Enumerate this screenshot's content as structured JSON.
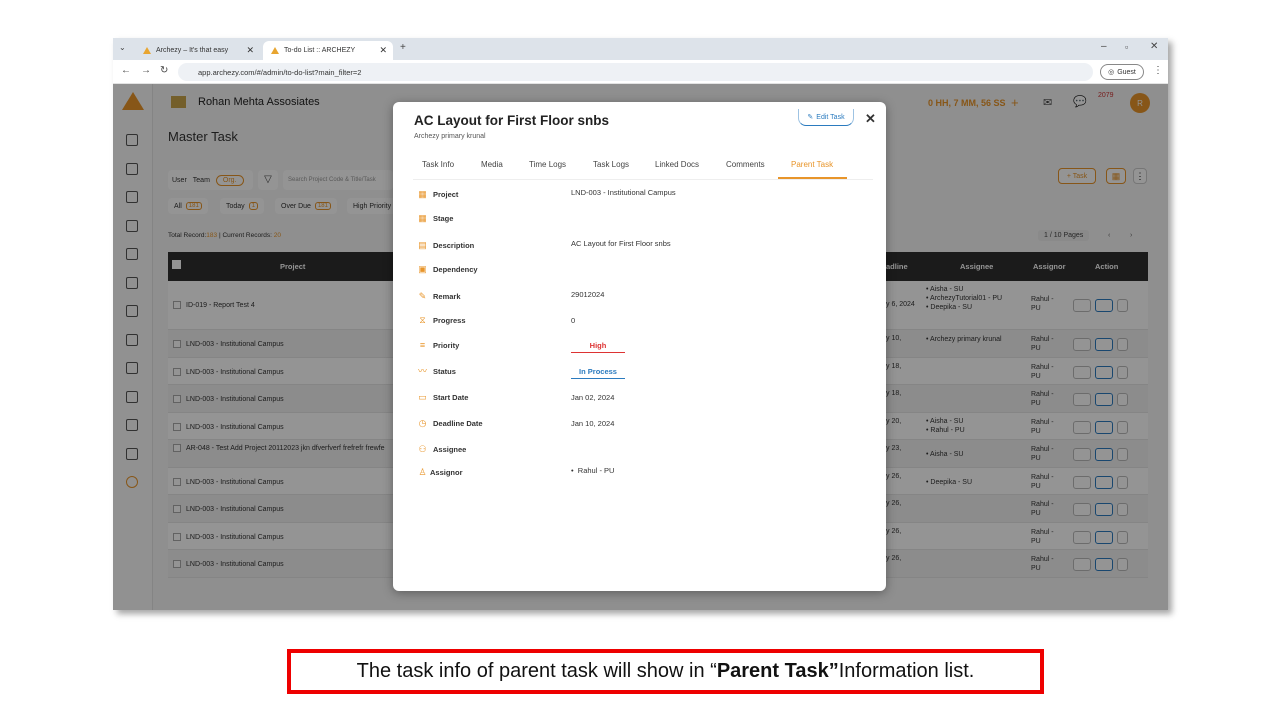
{
  "browser": {
    "tabs": [
      {
        "title": "Archezy – It's that easy",
        "active": false
      },
      {
        "title": "To-do List :: ARCHEZY",
        "active": true
      }
    ],
    "url": "app.archezy.com/#/admin/to-do-list?main_filter=2",
    "profile_label": "Guest"
  },
  "app": {
    "org_name": "Rohan Mehta Assosiates",
    "page_title": "Master Task",
    "timer": "0 HH, 7 MM, 56 SS",
    "avatar_initial": "R",
    "notification_year": "2079",
    "filter": {
      "user": "User",
      "team": "Team",
      "org": "Org."
    },
    "search_placeholder": "Search Project Code & Title/Task",
    "chips": [
      {
        "label": "All",
        "count": "181"
      },
      {
        "label": "Today",
        "count": "1"
      },
      {
        "label": "Over Due",
        "count": "181"
      },
      {
        "label": "High Priority",
        "count": ""
      }
    ],
    "total_label": "Total Record:",
    "total_value": "183",
    "current_label": " | Current Records: ",
    "current_value": "20",
    "pages": "1 / 10 Pages",
    "task_button": "+ Task",
    "columns": {
      "project": "Project",
      "deadline": "adline",
      "assignee": "Assignee",
      "assignor": "Assignor",
      "action": "Action"
    },
    "rows": [
      {
        "project": "ID-019 - Report Test 4",
        "deadline": "y 6, 2024",
        "assignee": [
          "Aisha - SU",
          "ArchezyTutorial01 - PU",
          "Deepika - SU"
        ],
        "assignor": "Rahul - PU"
      },
      {
        "project": "LND-003 - Institutional Campus",
        "deadline": "y 10,",
        "assignee": [
          "Archezy primary krunal"
        ],
        "assignor": "Rahul - PU"
      },
      {
        "project": "LND-003 - Institutional Campus",
        "deadline": "y 18,",
        "assignee": [],
        "assignor": "Rahul - PU"
      },
      {
        "project": "LND-003 - Institutional Campus",
        "deadline": "y 18,",
        "assignee": [],
        "assignor": "Rahul - PU"
      },
      {
        "project": "LND-003 - Institutional Campus",
        "deadline": "y 20,",
        "assignee": [
          "Aisha - SU",
          "Rahul - PU"
        ],
        "assignor": "Rahul - PU"
      },
      {
        "project": "AR-048 - Test Add Project 20112023 jkn dfverfverf frefrefr frewfe",
        "deadline": "y 23,",
        "assignee": [
          "Aisha - SU"
        ],
        "assignor": "Rahul - PU"
      },
      {
        "project": "LND-003 - Institutional Campus",
        "deadline": "y 26,",
        "assignee": [
          "Deepika - SU"
        ],
        "assignor": "Rahul - PU"
      },
      {
        "project": "LND-003 - Institutional Campus",
        "deadline": "y 26,",
        "assignee": [],
        "assignor": "Rahul - PU"
      },
      {
        "project": "LND-003 - Institutional Campus",
        "deadline": "y 26,",
        "assignee": [],
        "assignor": "Rahul - PU"
      },
      {
        "project": "LND-003 - Institutional Campus",
        "deadline": "y 26,",
        "assignee": [],
        "assignor": "Rahul - PU"
      }
    ]
  },
  "modal": {
    "title": "AC Layout for First Floor snbs",
    "subtitle": "Archezy primary krunal",
    "edit_label": "Edit Task",
    "close_label": "✕",
    "tabs": [
      "Task Info",
      "Media",
      "Time Logs",
      "Task Logs",
      "Linked Docs",
      "Comments",
      "Parent Task"
    ],
    "active_tab": "Parent Task",
    "fields": {
      "project": {
        "label": "Project",
        "value": "LND-003 - Institutional Campus"
      },
      "stage": {
        "label": "Stage",
        "value": ""
      },
      "description": {
        "label": "Description",
        "value": "AC Layout for First Floor snbs"
      },
      "dependency": {
        "label": "Dependency",
        "value": ""
      },
      "remark": {
        "label": "Remark",
        "value": "29012024"
      },
      "progress": {
        "label": "Progress",
        "value": "0"
      },
      "priority": {
        "label": "Priority",
        "value": "High"
      },
      "status": {
        "label": "Status",
        "value": "In Process"
      },
      "start_date": {
        "label": "Start Date",
        "value": "Jan 02, 2024"
      },
      "deadline_date": {
        "label": "Deadline Date",
        "value": "Jan 10, 2024"
      },
      "assignee": {
        "label": "Assignee",
        "value": ""
      },
      "assignor": {
        "label": "Assignor",
        "value": "Rahul - PU"
      }
    }
  },
  "caption": {
    "before": "The task info of parent task will show in “",
    "bold": "Parent Task”",
    "after": " Information list."
  },
  "colors": {
    "accent": "#e8952a",
    "high": "#dd3333",
    "in_process": "#2b7bbf",
    "caption_border": "#ee0000"
  }
}
